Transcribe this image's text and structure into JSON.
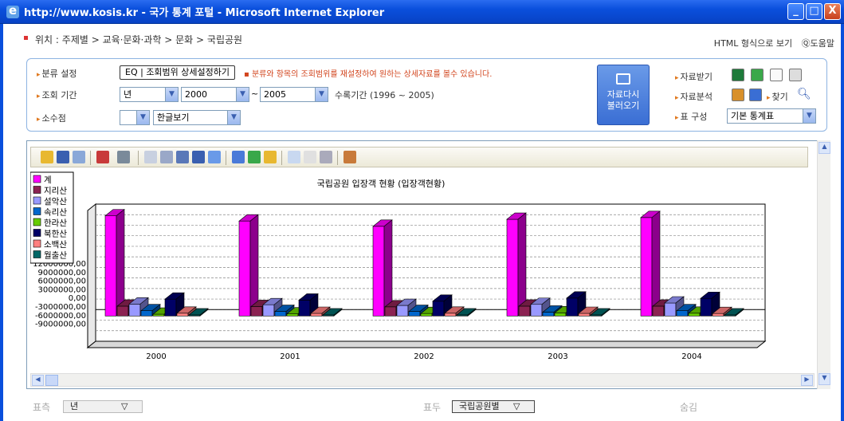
{
  "window": {
    "title": "http://www.kosis.kr - 국가 통계 포털 - Microsoft Internet Explorer",
    "buttons": {
      "minimize": "_",
      "maximize": "□",
      "close": "X"
    }
  },
  "location": {
    "label": "위치 :",
    "breadcrumb": "주제별 > 교육·문화·과학 > 문화 > 국립공원",
    "html_view": "HTML 형식으로 보기",
    "help": "도움말"
  },
  "controls": {
    "category_label": "분류 설정",
    "range_button": "조회범위 상세설정하기",
    "range_button_prefix": "EQ | ",
    "hint": "▪ 분류와 항목의 조회범위를 재설정하여 원하는 상세자료를 볼수 있습니다.",
    "period_label": "조회 기간",
    "period_unit": "년",
    "period_from": "2000",
    "period_tilde": "~",
    "period_to": "2005",
    "period_range": "수록기간 (1996 ~ 2005)",
    "decimal_label": "소수점",
    "decimal_value": "",
    "view_mode": "한글보기",
    "reload_button": "자료다시\n불러오기",
    "download_label": "자료받기",
    "analysis_label": "자료분석",
    "find_label": "찾기",
    "table_label": "표 구성",
    "table_value": "기본 통계표"
  },
  "chart_data": {
    "type": "bar",
    "title": "국립공원 입장객 현황 (입장객현황)",
    "categories": [
      "2000",
      "2001",
      "2002",
      "2003",
      "2004"
    ],
    "series": [
      {
        "name": "계",
        "color": "#ff00ff",
        "values": [
          28500000,
          27000000,
          25500000,
          27500000,
          28000000
        ]
      },
      {
        "name": "지리산",
        "color": "#8b2252",
        "values": [
          2800000,
          2700000,
          2600000,
          2800000,
          2800000
        ]
      },
      {
        "name": "설악산",
        "color": "#9999ff",
        "values": [
          3400000,
          3200000,
          3000000,
          3300000,
          3700000
        ]
      },
      {
        "name": "속리산",
        "color": "#0066cc",
        "values": [
          1500000,
          1300000,
          1300000,
          1100000,
          1500000
        ]
      },
      {
        "name": "한라산",
        "color": "#66cc00",
        "values": [
          500000,
          600000,
          700000,
          900000,
          800000
        ]
      },
      {
        "name": "북한산",
        "color": "#000066",
        "values": [
          4800000,
          4500000,
          4200000,
          5100000,
          5000000
        ]
      },
      {
        "name": "소백산",
        "color": "#ff8080",
        "values": [
          800000,
          750000,
          800000,
          750000,
          700000
        ]
      },
      {
        "name": "월출산",
        "color": "#006666",
        "values": [
          300000,
          300000,
          300000,
          300000,
          300000
        ]
      }
    ],
    "ytick_labels": [
      "12000000,00",
      "9000000,00",
      "6000000,00",
      "3000000,00",
      "0,00",
      "-3000000,00",
      "-6000000,00",
      "-9000000,00"
    ],
    "ylim": [
      -9000000,
      30000000
    ],
    "grid": true,
    "legend_position": "top-left"
  },
  "bottom": {
    "row_label": "표측",
    "row_value": "년",
    "col_label": "표두",
    "col_value": "국립공원별",
    "hide_label": "숨김",
    "dropdown": "▽"
  }
}
